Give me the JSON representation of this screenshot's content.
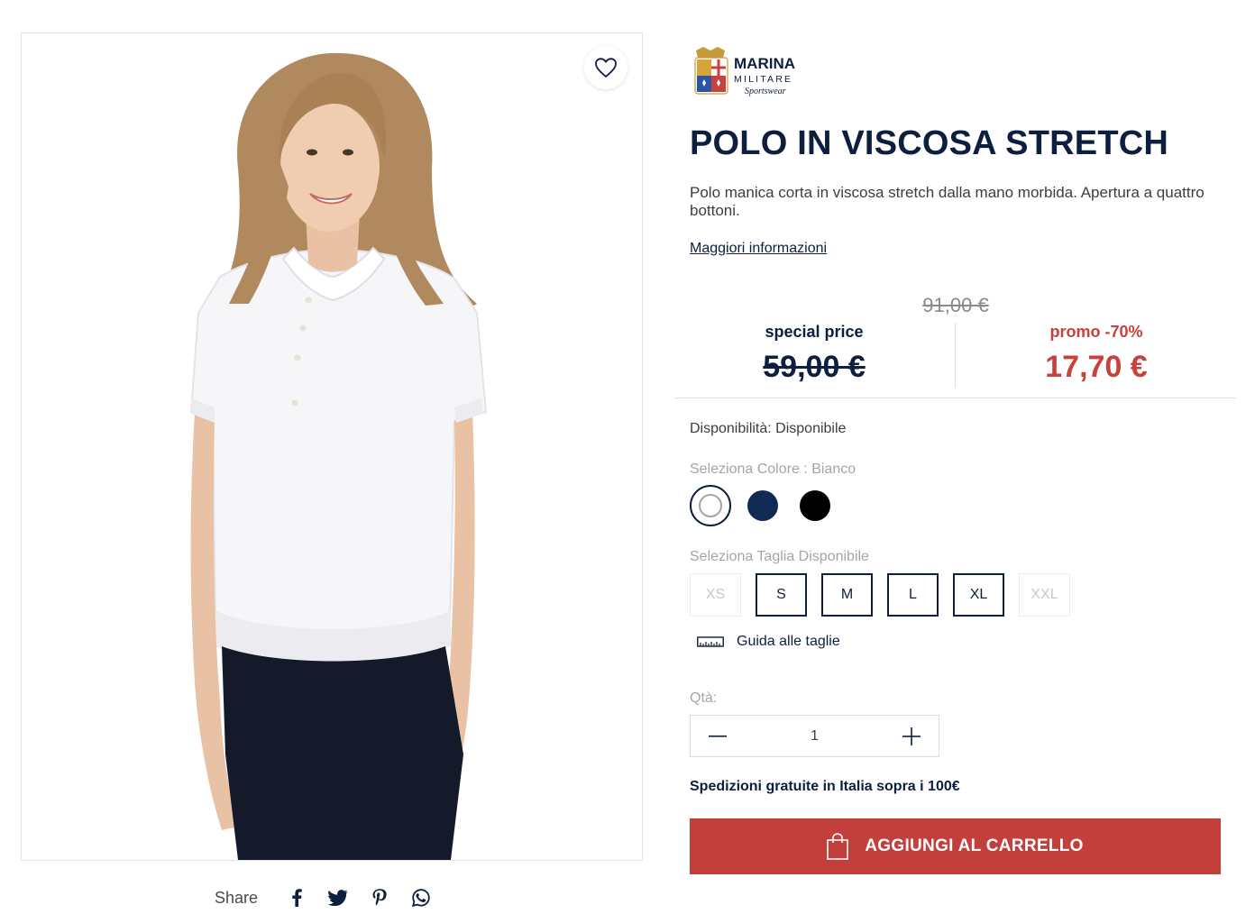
{
  "brand": {
    "name_line1": "MARINA",
    "name_line2": "MILITARE",
    "name_line3": "Sportswear"
  },
  "product": {
    "title": "POLO IN VISCOSA STRETCH",
    "description": "Polo manica corta in viscosa stretch dalla mano morbida. Apertura a quattro bottoni.",
    "more_info_link": "Maggiori informazioni"
  },
  "pricing": {
    "original_price": "91,00 €",
    "special_label": "special price",
    "special_price": "59,00 €",
    "promo_label": "promo -70%",
    "promo_price": "17,70 €"
  },
  "availability": "Disponibilità: Disponibile",
  "color": {
    "label": "Seleziona Colore : Bianco",
    "options": [
      {
        "name": "white",
        "hex": "#ffffff",
        "selected": true
      },
      {
        "name": "navy",
        "hex": "#102a55",
        "selected": false
      },
      {
        "name": "black",
        "hex": "#000000",
        "selected": false
      }
    ]
  },
  "size": {
    "label": "Seleziona Taglia Disponibile",
    "options": [
      "XS",
      "S",
      "M",
      "L",
      "XL",
      "XXL"
    ],
    "disabled": [
      "XS",
      "XXL"
    ],
    "guide_label": "Guida alle taglie"
  },
  "quantity": {
    "label": "Qtà:",
    "value": "1"
  },
  "shipping_note": "Spedizioni gratuite in Italia sopra i 100€",
  "cart_button": "AGGIUNGI AL CARRELLO",
  "share": {
    "label": "Share",
    "icons": [
      "facebook-icon",
      "twitter-icon",
      "pinterest-icon",
      "whatsapp-icon"
    ]
  },
  "colors": {
    "navy": "#0c1f3f",
    "promo_red": "#c8413c",
    "cart_red": "#c33f3b"
  }
}
